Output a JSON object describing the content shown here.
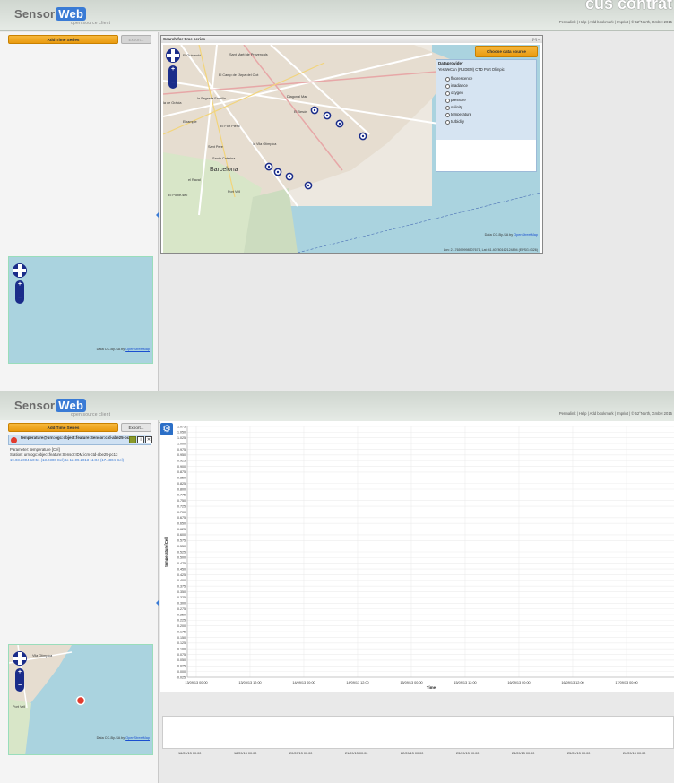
{
  "app": {
    "logo_main": "Sensor",
    "logo_web": "Web",
    "tagline": "open source client",
    "header_links": "Permalink | Help | Add bookmark | Imprint | © 52°North, GmbH 2015",
    "header_title": "cus contrat"
  },
  "toolbar": {
    "add_label": "Add Time Series",
    "export_label": "Export..."
  },
  "search_dialog": {
    "title": "Search for time series",
    "close_label": "[X] x",
    "choose_label": "Choose data source",
    "dataprovider_header": "Dataprovider",
    "dataprovider_name": "YesWeCan (RUDEM) CTD Port Olimpic",
    "phenomena": [
      "fluorescence",
      "irradiance",
      "oxygen",
      "pressure",
      "salinity",
      "temperature",
      "turbidity"
    ],
    "latlon": "Lon: 2.176599998507671, Lat: 41.40780162124894 (EPSG:4326)",
    "map_labels": [
      "El Guinardó",
      "Sant Martí de Provençals",
      "El Camp de l'Arpa del Clot",
      "la Sagrada Família",
      "Diagonal Mar",
      "la de Gràcia",
      "El Besòs",
      "Eixample",
      "El Fort Pienc",
      "Sant Pere",
      "la Vila Olímpica",
      "Santa Caterina",
      "Barcelona",
      "el Raval",
      "El Poble-sec",
      "Port Vell"
    ]
  },
  "minimap": {
    "attribution": "Data CC-By-SA by",
    "attribution_link": "OpenStreetMap",
    "labels": [
      "Vila Olímpica",
      "Port Vell"
    ]
  },
  "timeseries": {
    "title": "temperature@urn:ogc:object:feature:Sensor:cid-abe25-pct3",
    "parameter": "Parameter: temperature [Cel]",
    "station": "Station: urn:ogc:object:feature:Sensor:IDM:icm-ctd-abe25-pc13",
    "range": "19.03.2004 10:51 (13.2300 Cel) to 12.09.2013 11:04 (17.4804 Cel)",
    "color": "#e23b2e"
  },
  "chart_data": {
    "type": "line",
    "ylabel": "temperature[Cel]",
    "xlabel": "Time",
    "ylim": [
      -0.025,
      1.075
    ],
    "y_ticks": [
      "1.075",
      "1.050",
      "1.025",
      "1.000",
      "0.975",
      "0.950",
      "0.925",
      "0.900",
      "0.875",
      "0.850",
      "0.825",
      "0.800",
      "0.775",
      "0.750",
      "0.725",
      "0.700",
      "0.675",
      "0.650",
      "0.625",
      "0.600",
      "0.575",
      "0.550",
      "0.525",
      "0.500",
      "0.475",
      "0.450",
      "0.425",
      "0.400",
      "0.375",
      "0.350",
      "0.325",
      "0.300",
      "0.275",
      "0.250",
      "0.225",
      "0.200",
      "0.175",
      "0.150",
      "0.125",
      "0.100",
      "0.075",
      "0.050",
      "0.025",
      "0.000",
      "-0.025"
    ],
    "x_ticks": [
      "13/09/13 00:00",
      "13/09/13 12:00",
      "14/09/13 00:00",
      "14/09/13 12:00",
      "15/09/13 00:00",
      "15/09/13 12:00",
      "16/09/13 00:00",
      "16/09/13 12:00",
      "17/09/13 00:00"
    ],
    "overview_ticks": [
      "16/09/13 00:00",
      "18/09/13 00:00",
      "20/09/13 00:00",
      "21/09/13 00:00",
      "22/09/13 00:00",
      "23/09/13 00:00",
      "24/09/13 00:00",
      "25/09/13 00:00",
      "26/09/13 00:00"
    ],
    "series": []
  }
}
